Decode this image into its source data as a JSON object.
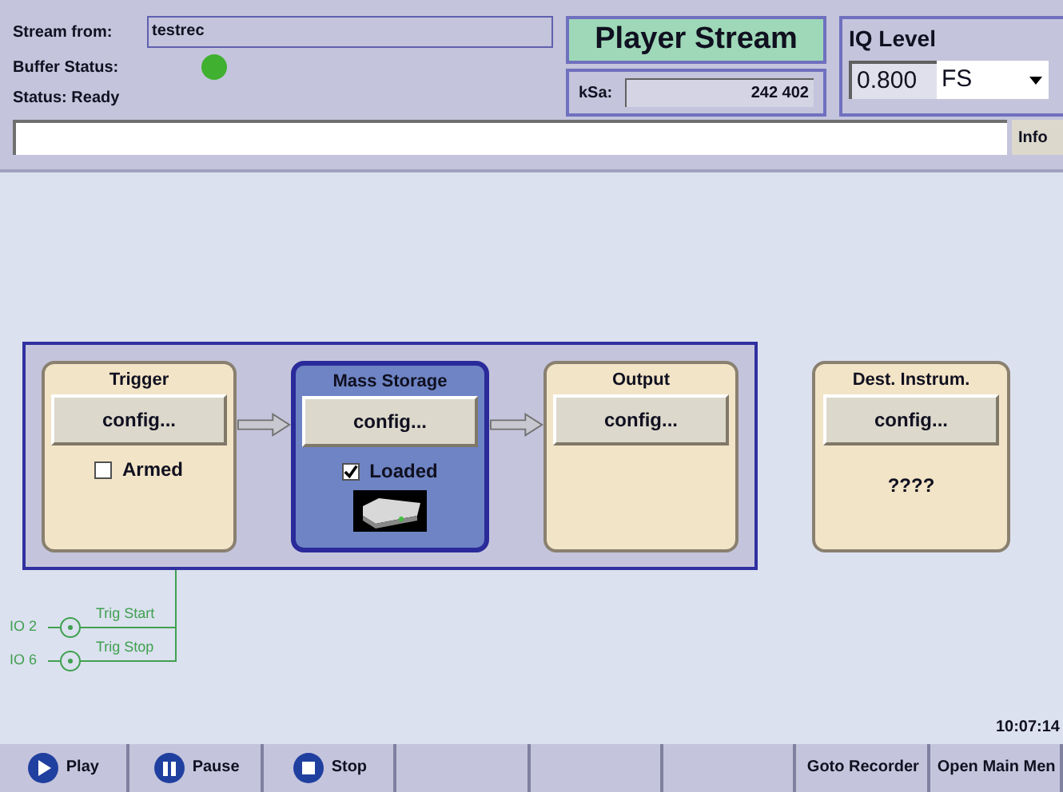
{
  "header": {
    "stream_from_label": "Stream from:",
    "stream_from_value": "testrec",
    "buffer_status_label": "Buffer Status:",
    "buffer_ok": true,
    "status": "Status: Ready",
    "title": "Player Stream",
    "ksa_label": "kSa:",
    "ksa_value": "242 402",
    "iq_level_label": "IQ Level",
    "iq_level_value": "0.800",
    "iq_unit": "FS",
    "info_button": "Info"
  },
  "chain": [
    {
      "title": "Trigger",
      "button": "config...",
      "selected": false,
      "checkbox": {
        "label": "Armed",
        "checked": false
      }
    },
    {
      "title": "Mass Storage",
      "button": "config...",
      "selected": true,
      "checkbox": {
        "label": "Loaded",
        "checked": true
      },
      "kind": "storage"
    },
    {
      "title": "Output",
      "button": "config...",
      "selected": false
    }
  ],
  "destination": {
    "title": "Dest. Instrum.",
    "button": "config...",
    "text": "????"
  },
  "trigger_inputs": [
    {
      "port": "IO 2",
      "label": "Trig Start"
    },
    {
      "port": "IO 6",
      "label": "Trig Stop"
    }
  ],
  "time": "10:07:14",
  "softkeys": [
    {
      "label": "Play",
      "kind": "play"
    },
    {
      "label": "Pause",
      "kind": "pause"
    },
    {
      "label": "Stop",
      "kind": "stop"
    },
    {
      "kind": "empty"
    },
    {
      "kind": "empty"
    },
    {
      "kind": "empty"
    },
    {
      "label": "Goto Recorder",
      "kind": "text"
    },
    {
      "label": "Open Main Men",
      "kind": "text"
    }
  ]
}
